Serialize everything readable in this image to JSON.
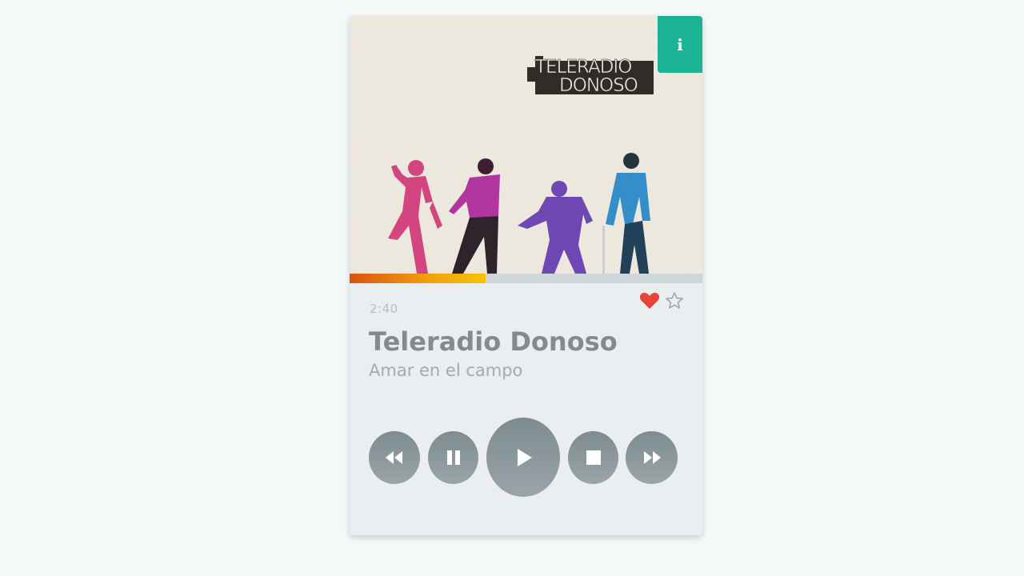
{
  "album_cover": {
    "logo_line1": "TELERADIO",
    "logo_line2": "DONOSO"
  },
  "info_button": {
    "label": "i",
    "color": "#1ab394"
  },
  "progress": {
    "fraction": 0.385,
    "color_start": "#d9530f",
    "color_end": "#f5c300"
  },
  "track": {
    "time": "2:40",
    "artist": "Teleradio Donoso",
    "title": "Amar en el campo",
    "liked": true,
    "starred": false
  },
  "controls": [
    {
      "name": "rewind",
      "icon": "rewind-icon"
    },
    {
      "name": "pause",
      "icon": "pause-icon"
    },
    {
      "name": "play",
      "icon": "play-icon"
    },
    {
      "name": "stop",
      "icon": "stop-icon"
    },
    {
      "name": "fast-forward",
      "icon": "fast-forward-icon"
    }
  ],
  "colors": {
    "heart": "#e8443a",
    "control": "#8a9699"
  }
}
